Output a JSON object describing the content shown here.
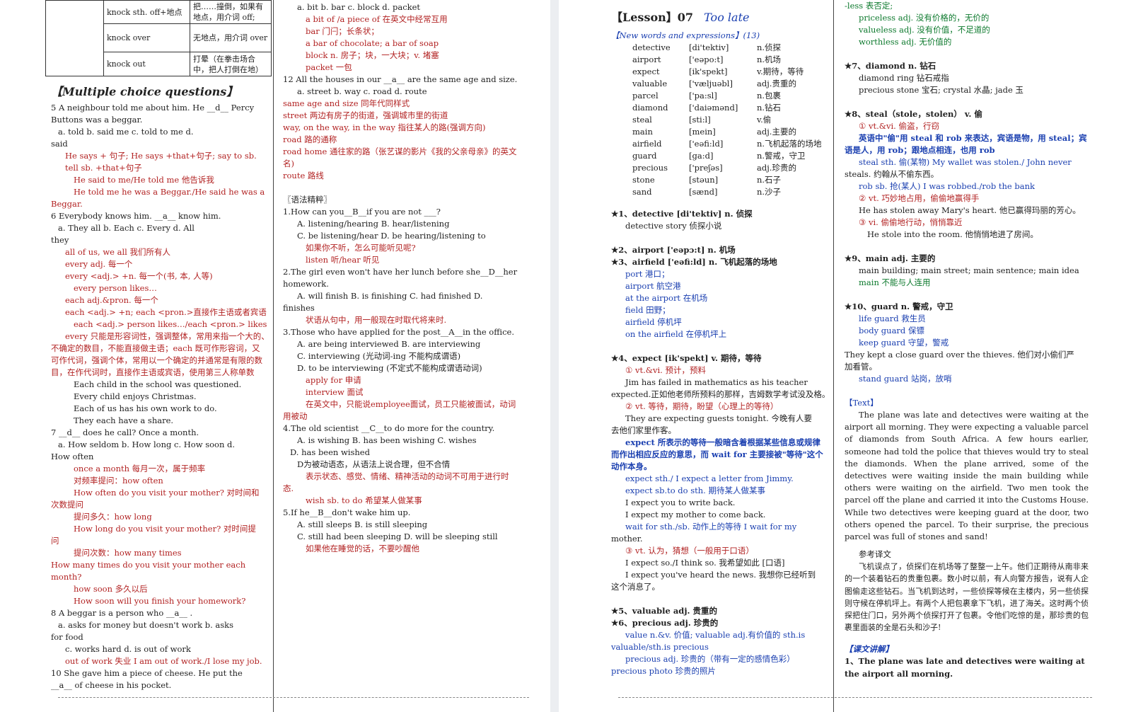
{
  "knock_table": [
    {
      "phrase": "knock sth. off+地点",
      "meaning": "把……撞倒，如果有地点，用介词 off;"
    },
    {
      "phrase": "knock over",
      "meaning": "无地点，用介词 over"
    },
    {
      "phrase": "knock out",
      "meaning": "打晕（在拳击场合中，把人打倒在地）"
    }
  ],
  "col1": {
    "heading": "【Multiple choice questions】",
    "lines": [
      {
        "t": "5  A neighbour told me about him. He __d__ Percy",
        "c": "dk"
      },
      {
        "t": "Buttons was a beggar.",
        "c": "dk"
      },
      {
        "t": "a. told       b. said me       c. told to me          d.",
        "c": "dk",
        "i": 1
      },
      {
        "t": "said",
        "c": "dk"
      },
      {
        "t": "He says + 句子; He says +that+句子; say to sb.",
        "c": "red",
        "i": 2
      },
      {
        "t": "tell sb. +that+句子",
        "c": "red",
        "i": 2
      },
      {
        "t": "He said to me/He told me     他告诉我",
        "c": "red",
        "i": 3
      },
      {
        "t": "He told me he was a Beggar./He said he was a",
        "c": "red",
        "i": 3
      },
      {
        "t": "Beggar.",
        "c": "red"
      },
      {
        "t": "6  Everybody knows him. __a__ know him.",
        "c": "dk"
      },
      {
        "t": "a. They all          b. Each          c. Every       d. All",
        "c": "dk",
        "i": 1
      },
      {
        "t": "they",
        "c": "dk"
      },
      {
        "t": "all of us, we all    我们所有人",
        "c": "red",
        "i": 2
      },
      {
        "t": "every      adj. 每一个",
        "c": "red",
        "i": 2
      },
      {
        "t": "every <adj.> +n. 每一个(书, 本, 人等)",
        "c": "red",
        "i": 2
      },
      {
        "t": "every person likes…",
        "c": "red",
        "i": 3
      },
      {
        "t": "each       adj.&pron. 每一个",
        "c": "red",
        "i": 2
      },
      {
        "t": "each <adj.> +n; each <pron.>直接作主语或者宾语",
        "c": "red",
        "i": 2
      },
      {
        "t": "each <adj.> person likes…/each <pron.> likes…",
        "c": "red",
        "i": 3
      },
      {
        "t": "every 只能是形容词性，强调整体，常用来指一个大的、",
        "c": "red",
        "i": 2
      },
      {
        "t": "不确定的数目，不能直接做主语；each 既可作形容词，又",
        "c": "red"
      },
      {
        "t": "可作代词，强调个体，常用以一个确定的并通常是有限的数",
        "c": "red"
      },
      {
        "t": "目，在作代词时，直接作主语或宾语，使用第三人称单数",
        "c": "red"
      },
      {
        "t": "Each child in the school was questioned.",
        "c": "dk",
        "i": 3
      },
      {
        "t": "Every child enjoys Christmas.",
        "c": "dk",
        "i": 3
      },
      {
        "t": "Each of us has his own work to do.",
        "c": "dk",
        "i": 3
      },
      {
        "t": "They each have a share.",
        "c": "dk",
        "i": 3
      },
      {
        "t": "7   __d__ does he call? Once a month.",
        "c": "dk"
      },
      {
        "t": "a. How seldom       b. How long    c. How soon     d.",
        "c": "dk",
        "i": 1
      },
      {
        "t": "How often",
        "c": "dk"
      },
      {
        "t": "once a month    每月一次，属于频率",
        "c": "red",
        "i": 3
      },
      {
        "t": "对频率提问：how often",
        "c": "red",
        "i": 3
      },
      {
        "t": "How often do you visit your mother?    对时间和",
        "c": "red",
        "i": 3
      },
      {
        "t": "次数提问",
        "c": "red"
      },
      {
        "t": "提问多久：how long",
        "c": "red",
        "i": 3
      },
      {
        "t": "How long do you visit your mother?     对时间提",
        "c": "red",
        "i": 3
      },
      {
        "t": "问",
        "c": "red"
      },
      {
        "t": "提问次数：how many times",
        "c": "red",
        "i": 3
      },
      {
        "t": "How many times do you visit your mother each",
        "c": "red"
      },
      {
        "t": "month?",
        "c": "red"
      },
      {
        "t": "how soon 多久以后",
        "c": "red",
        "i": 3
      },
      {
        "t": "How soon will you finish your homework?",
        "c": "red",
        "i": 3
      },
      {
        "t": "8   A beggar is a person who __a__ .",
        "c": "dk"
      },
      {
        "t": "a. asks for money but doesn't work            b.   asks",
        "c": "dk",
        "i": 1
      },
      {
        "t": "for food",
        "c": "dk"
      },
      {
        "t": "c. works hard                          d. is out of work",
        "c": "dk",
        "i": 2
      },
      {
        "t": "out of work 失业 I am out of work./I lose my job.",
        "c": "red",
        "i": 2
      },
      {
        "t": "10   She gave him a piece of cheese. He put the",
        "c": "dk"
      },
      {
        "t": "__a__ of cheese in his pocket.",
        "c": "dk"
      }
    ]
  },
  "col2": {
    "lines": [
      {
        "t": "a. bit        b. bar        c. block          d. packet",
        "c": "dk",
        "i": 2
      },
      {
        "t": "a bit of /a piece of 在英文中经常互用",
        "c": "red",
        "i": 3
      },
      {
        "t": "bar 门闩；长条状；",
        "c": "red",
        "i": 3
      },
      {
        "t": "a bar of chocolate;   a bar of soap",
        "c": "red",
        "i": 3
      },
      {
        "t": "block     n. 房子；块，一大块；v. 堵塞",
        "c": "red",
        "i": 3
      },
      {
        "t": "packet    一包",
        "c": "red",
        "i": 3
      },
      {
        "t": "12   All the houses in our __a__ are the same age and size.",
        "c": "dk"
      },
      {
        "t": "a. street          b. way      c. road        d. route",
        "c": "dk",
        "i": 2
      },
      {
        "t": "same age and size 同年代同样式",
        "c": "red"
      },
      {
        "t": "street 两边有房子的街道，强调城市里的街道",
        "c": "red"
      },
      {
        "t": "way, on the way, in the way 指往某人的路(强调方向)",
        "c": "red"
      },
      {
        "t": "road  路的通称",
        "c": "red"
      },
      {
        "t": "road home 通往家的路（张艺谋的影片《我的父亲母亲》的英文",
        "c": "red"
      },
      {
        "t": "名)",
        "c": "red"
      },
      {
        "t": "route  路线",
        "c": "red"
      },
      {
        "t": "",
        "c": "dk"
      },
      {
        "t": "〖语法精粹〗",
        "c": "dk"
      },
      {
        "t": "1.How can you__B__if you are not ___?",
        "c": "dk"
      },
      {
        "t": "A. listening/hearing        B. hear/listening",
        "c": "dk",
        "i": 2
      },
      {
        "t": "C. be listening/hear        D. be hearing/listening to",
        "c": "dk",
        "i": 2
      },
      {
        "t": "如果你不听，怎么可能听见呢?",
        "c": "red",
        "i": 3
      },
      {
        "t": "listen 听/hear 听见",
        "c": "red",
        "i": 3
      },
      {
        "t": "2.The girl even won't have her lunch before she__D__her",
        "c": "dk"
      },
      {
        "t": "homework.",
        "c": "dk"
      },
      {
        "t": "A. will finish    B. is finishing    C. had finished     D.",
        "c": "dk",
        "i": 2
      },
      {
        "t": "finishes",
        "c": "dk"
      },
      {
        "t": "状语从句中，用一般现在时取代将来时.",
        "c": "red",
        "i": 3
      },
      {
        "t": "3.Those who have applied for the post__A__in the office.",
        "c": "dk"
      },
      {
        "t": "A. are being interviewed             B. are interviewing",
        "c": "dk",
        "i": 2
      },
      {
        "t": "C. interviewing (光动词-ing 不能构成谓语)",
        "c": "dk",
        "i": 2
      },
      {
        "t": "D. to be interviewing (不定式不能构成谓语动词)",
        "c": "dk",
        "i": 2
      },
      {
        "t": "apply for      申请",
        "c": "red",
        "i": 3
      },
      {
        "t": "interview      面试",
        "c": "red",
        "i": 3
      },
      {
        "t": "在英文中，只能说employee面试，员工只能被面试，动词",
        "c": "red",
        "i": 3
      },
      {
        "t": "用被动",
        "c": "red"
      },
      {
        "t": "4.The old scientist __C__to do more for the country.",
        "c": "dk"
      },
      {
        "t": "A. is wishing        B. has been wishing        C. wishes",
        "c": "dk",
        "i": 2
      },
      {
        "t": "D. has been wished",
        "c": "dk",
        "i": 1
      },
      {
        "t": "D为被动语态，从语法上说合理，但不合情",
        "c": "dk",
        "i": 2
      },
      {
        "t": "表示状态、感觉、情绪、精神活动的动词不可用于进行时",
        "c": "red",
        "i": 3
      },
      {
        "t": "态.",
        "c": "red"
      },
      {
        "t": "wish sb. to do   希望某人做某事",
        "c": "red",
        "i": 3
      },
      {
        "t": "5.If he__B__don't wake him up.",
        "c": "dk"
      },
      {
        "t": "A. still sleeps                     B. is still sleeping",
        "c": "dk",
        "i": 2
      },
      {
        "t": "C. still had been sleeping       D. will be sleeping still",
        "c": "dk",
        "i": 2
      },
      {
        "t": "如果他在睡觉的话，不要吵醒他",
        "c": "red",
        "i": 3
      }
    ]
  },
  "col3": {
    "lesson": "【Lesson】07",
    "lesson_title": "Too late",
    "new_words_heading": "【New words and expressions】(13)",
    "words": [
      {
        "w": "detective",
        "p": "[di'tektiv]",
        "m": "n.侦探"
      },
      {
        "w": "airport",
        "p": "['eəpo:t]",
        "m": "n.机场"
      },
      {
        "w": "expect",
        "p": "[ik'spekt]",
        "m": "v.期待，等待"
      },
      {
        "w": "valuable",
        "p": "['væljuəbl]",
        "m": "adj.贵重的"
      },
      {
        "w": "parcel",
        "p": "['pa:sl]",
        "m": "n.包裹"
      },
      {
        "w": "diamond",
        "p": "['daiəmənd]",
        "m": "n.钻石"
      },
      {
        "w": "steal",
        "p": "[sti:l]",
        "m": "v.偷"
      },
      {
        "w": "main",
        "p": "[mein]",
        "m": "adj.主要的"
      },
      {
        "w": "airfield",
        "p": "['eəfi:ld]",
        "m": "n.飞机起落的场地"
      },
      {
        "w": "guard",
        "p": "[ga:d]",
        "m": "n.警戒，守卫"
      },
      {
        "w": "precious",
        "p": "['preʃəs]",
        "m": "adj.珍贵的"
      },
      {
        "w": "stone",
        "p": "[stəun]",
        "m": "n.石子"
      },
      {
        "w": "sand",
        "p": "[sænd]",
        "m": "n.沙子"
      }
    ],
    "lines": [
      {
        "t": "★1、detective [di'tektiv]  n. 侦探",
        "c": "dk",
        "b": true
      },
      {
        "t": "detective story     侦探小说",
        "c": "dk",
        "i": 2
      },
      {
        "t": "",
        "c": "dk"
      },
      {
        "t": "★2、airport ['eəpɔ:t]    n. 机场",
        "c": "dk",
        "b": true
      },
      {
        "t": "★3、airfield ['eəfi:ld]    n. 飞机起落的场地",
        "c": "dk",
        "b": true
      },
      {
        "t": "port   港口；",
        "c": "blue",
        "i": 2
      },
      {
        "t": "airport   航空港",
        "c": "blue",
        "i": 2
      },
      {
        "t": "at the airport 在机场",
        "c": "blue",
        "i": 2
      },
      {
        "t": "field  田野；",
        "c": "blue",
        "i": 2
      },
      {
        "t": "airfield  停机坪",
        "c": "blue",
        "i": 2
      },
      {
        "t": "on the airfield 在停机坪上",
        "c": "blue",
        "i": 2
      },
      {
        "t": "",
        "c": "dk"
      },
      {
        "t": "★4、expect [ik'spekt] v. 期待，等待",
        "c": "dk",
        "b": true
      },
      {
        "t": "① vt.&vi.  预计，预料",
        "c": "red",
        "i": 2
      },
      {
        "t": "Jim has failed in mathematics as his teacher",
        "c": "dk",
        "i": 2
      },
      {
        "t": "expected.正如他老师所预料的那样，吉姆数学考试没及格。",
        "c": "dk"
      },
      {
        "t": "② vt. 等待，期待，盼望（心理上的等待）",
        "c": "red",
        "i": 2
      },
      {
        "t": "They are expecting guests tonight.     今晚有人要",
        "c": "dk",
        "i": 2
      },
      {
        "t": "去他们家里作客。",
        "c": "dk"
      },
      {
        "t": "expect 所表示的等待一般暗含着根据某些信息或规律",
        "c": "blue",
        "i": 2,
        "b": true
      },
      {
        "t": "而作出相应反应的意思，而 wait for 主要接被\"等待\"这个",
        "c": "blue",
        "b": true
      },
      {
        "t": "动作本身。",
        "c": "blue",
        "b": true
      },
      {
        "t": "expect sth./ I expect a letter from Jimmy.",
        "c": "blue",
        "i": 2
      },
      {
        "t": "expect sb.to do sth.   期待某人做某事",
        "c": "blue",
        "i": 2
      },
      {
        "t": "I expect you to write back.",
        "c": "dk",
        "i": 2
      },
      {
        "t": "I expect my mother to come back.",
        "c": "dk",
        "i": 2
      },
      {
        "t": "wait for sth./sb.   动作上的等待 I wait for my",
        "c": "blue",
        "i": 2
      },
      {
        "t": "mother.",
        "c": "dk"
      },
      {
        "t": "③ vt. 认为，猜想（一般用于口语）",
        "c": "red",
        "i": 2
      },
      {
        "t": "I expect so./I think so.   我希望如此 [口语]",
        "c": "dk",
        "i": 2
      },
      {
        "t": "I expect you've heard the news.   我想你已经听到",
        "c": "dk",
        "i": 2
      },
      {
        "t": "这个消息了。",
        "c": "dk"
      },
      {
        "t": "",
        "c": "dk"
      },
      {
        "t": "★5、valuable     adj. 贵重的",
        "c": "dk",
        "b": true
      },
      {
        "t": "★6、precious     adj. 珍贵的",
        "c": "dk",
        "b": true
      },
      {
        "t": "value   n.&v. 价值; valuable   adj.有价值的     sth.is",
        "c": "blue",
        "i": 2
      },
      {
        "t": "valuable/sth.is precious",
        "c": "blue"
      },
      {
        "t": "precious    adj. 珍贵的（带有一定的感情色彩）",
        "c": "blue",
        "i": 2
      },
      {
        "t": "precious photo     珍贵的照片",
        "c": "blue"
      }
    ]
  },
  "col4": {
    "lines": [
      {
        "t": "-less 表否定;",
        "c": "green"
      },
      {
        "t": "priceless     adj. 没有价格的，无价的",
        "c": "green",
        "i": 2
      },
      {
        "t": "valueless     adj. 没有价值，不足道的",
        "c": "green",
        "i": 2
      },
      {
        "t": "worthless     adj. 无价值的",
        "c": "green",
        "i": 2
      },
      {
        "t": "",
        "c": "dk"
      },
      {
        "t": "★7、diamond      n. 钻石",
        "c": "dk",
        "b": true
      },
      {
        "t": "diamond ring   钻石戒指",
        "c": "dk",
        "i": 2
      },
      {
        "t": "precious stone  宝石; crystal  水晶; jade   玉",
        "c": "dk",
        "i": 2
      },
      {
        "t": "",
        "c": "dk"
      },
      {
        "t": "★8、steal（stole，stolen）   v. 偷",
        "c": "dk",
        "b": true
      },
      {
        "t": "① vt.&vi. 偷盗，行窃",
        "c": "red",
        "i": 2
      },
      {
        "t": "英语中\"偷\"用 steal 和 rob 来表达，宾语是物，用 steal；宾",
        "c": "blue",
        "i": 2,
        "b": true
      },
      {
        "t": "语是人，用 rob；跟地点相连，也用 rob",
        "c": "blue",
        "b": true
      },
      {
        "t": "steal sth. 偷(某物) My wallet was stolen./ John never",
        "c": "blue",
        "i": 2
      },
      {
        "t": "steals.   约翰从不偷东西。",
        "c": "dk"
      },
      {
        "t": "rob sb. 抢(某人) I was robbed./rob the bank",
        "c": "blue",
        "i": 2
      },
      {
        "t": "② vt. 巧妙地占用，偷偷地赢得手",
        "c": "red",
        "i": 2
      },
      {
        "t": "He has stolen away Mary's heart.   他已赢得玛丽的芳心。",
        "c": "dk",
        "i": 2
      },
      {
        "t": "③ vi. 偷偷地行动，悄悄靠近",
        "c": "red",
        "i": 2
      },
      {
        "t": "He stole into the room.    他悄悄地进了房间。",
        "c": "dk",
        "i": 3
      },
      {
        "t": "",
        "c": "dk"
      },
      {
        "t": "★9、main     adj. 主要的",
        "c": "dk",
        "b": true
      },
      {
        "t": "main building; main street; main sentence; main idea",
        "c": "dk",
        "i": 2
      },
      {
        "t": "main 不能与人连用",
        "c": "green",
        "i": 2
      },
      {
        "t": "",
        "c": "dk"
      },
      {
        "t": "★10、guard      n. 警戒，守卫",
        "c": "dk",
        "b": true
      },
      {
        "t": "life guard     救生员",
        "c": "blue",
        "i": 2
      },
      {
        "t": "body guard     保镖",
        "c": "blue",
        "i": 2
      },
      {
        "t": "keep guard     守望，警戒",
        "c": "blue",
        "i": 2
      },
      {
        "t": "They kept a close guard over the thieves.     他们对小偷们严",
        "c": "dk"
      },
      {
        "t": "加看管。",
        "c": "dk"
      },
      {
        "t": "stand guard    站岗，放哨",
        "c": "blue",
        "i": 2
      },
      {
        "t": "",
        "c": "dk"
      },
      {
        "t": "【Text】",
        "c": "blue"
      }
    ],
    "text_paragraph": "The plane was late and detectives were waiting at the airport all morning. They were expecting a valuable parcel of diamonds from South Africa. A few hours earlier, someone had told the police that thieves would try to steal the diamonds. When the plane arrived, some of the detectives were waiting inside the main building while others were waiting on the airfield. Two men took the parcel off the plane and carried it into the Customs House. While two detectives were keeping guard at the door, two others opened the parcel. To their surprise, the precious parcel was full of stones and sand!",
    "ref_heading": "参考译文",
    "translation": "飞机误点了，侦探们在机场等了整整一上午。他们正期待从南非来的一个装着钻石的贵重包裹。数小时以前，有人向警方报告，说有人企图偷走这些钻石。当飞机到达时，一些侦探等候在主楼内，另一些侦探则守候在停机坪上。有两个人把包裹拿下飞机，进了海关。这时两个侦探把住门口，另外两个侦探打开了包裹。令他们吃惊的是，那珍贵的包裹里面装的全是石头和沙子!",
    "explain_heading": "【课文讲解】",
    "explain_1": "1、The plane was late and detectives were waiting at the airport all morning."
  }
}
